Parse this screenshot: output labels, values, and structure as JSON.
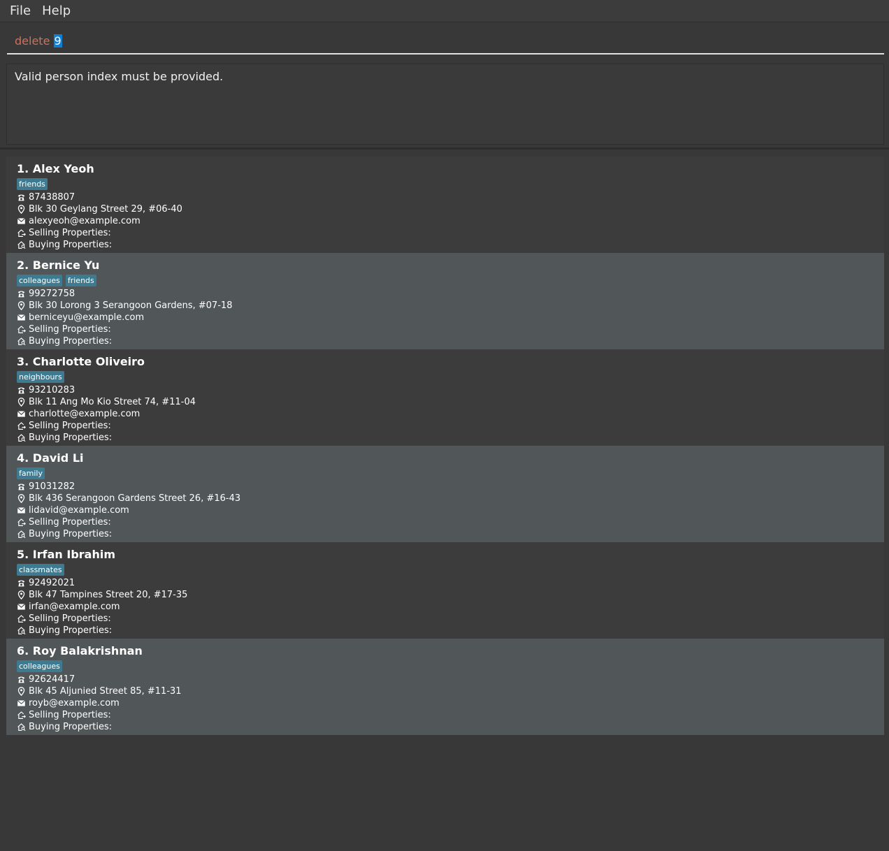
{
  "menu": {
    "file": "File",
    "help": "Help"
  },
  "command": {
    "text": "delete ",
    "selected": "9"
  },
  "result": {
    "message": "Valid person index must be provided."
  },
  "persons": [
    {
      "index": "1.",
      "name": "Alex Yeoh",
      "tags": [
        "friends"
      ],
      "phone": "87438807",
      "address": "Blk 30 Geylang Street 29, #06-40",
      "email": "alexyeoh@example.com",
      "selling": "Selling Properties:",
      "buying": "Buying Properties:"
    },
    {
      "index": "2.",
      "name": "Bernice Yu",
      "tags": [
        "colleagues",
        "friends"
      ],
      "phone": "99272758",
      "address": "Blk 30 Lorong 3 Serangoon Gardens, #07-18",
      "email": "berniceyu@example.com",
      "selling": "Selling Properties:",
      "buying": "Buying Properties:"
    },
    {
      "index": "3.",
      "name": "Charlotte Oliveiro",
      "tags": [
        "neighbours"
      ],
      "phone": "93210283",
      "address": "Blk 11 Ang Mo Kio Street 74, #11-04",
      "email": "charlotte@example.com",
      "selling": "Selling Properties:",
      "buying": "Buying Properties:"
    },
    {
      "index": "4.",
      "name": "David Li",
      "tags": [
        "family"
      ],
      "phone": "91031282",
      "address": "Blk 436 Serangoon Gardens Street 26, #16-43",
      "email": "lidavid@example.com",
      "selling": "Selling Properties:",
      "buying": "Buying Properties:"
    },
    {
      "index": "5.",
      "name": "Irfan Ibrahim",
      "tags": [
        "classmates"
      ],
      "phone": "92492021",
      "address": "Blk 47 Tampines Street 20, #17-35",
      "email": "irfan@example.com",
      "selling": "Selling Properties:",
      "buying": "Buying Properties:"
    },
    {
      "index": "6.",
      "name": "Roy Balakrishnan",
      "tags": [
        "colleagues"
      ],
      "phone": "92624417",
      "address": "Blk 45 Aljunied Street 85, #11-31",
      "email": "royb@example.com",
      "selling": "Selling Properties:",
      "buying": "Buying Properties:"
    }
  ]
}
